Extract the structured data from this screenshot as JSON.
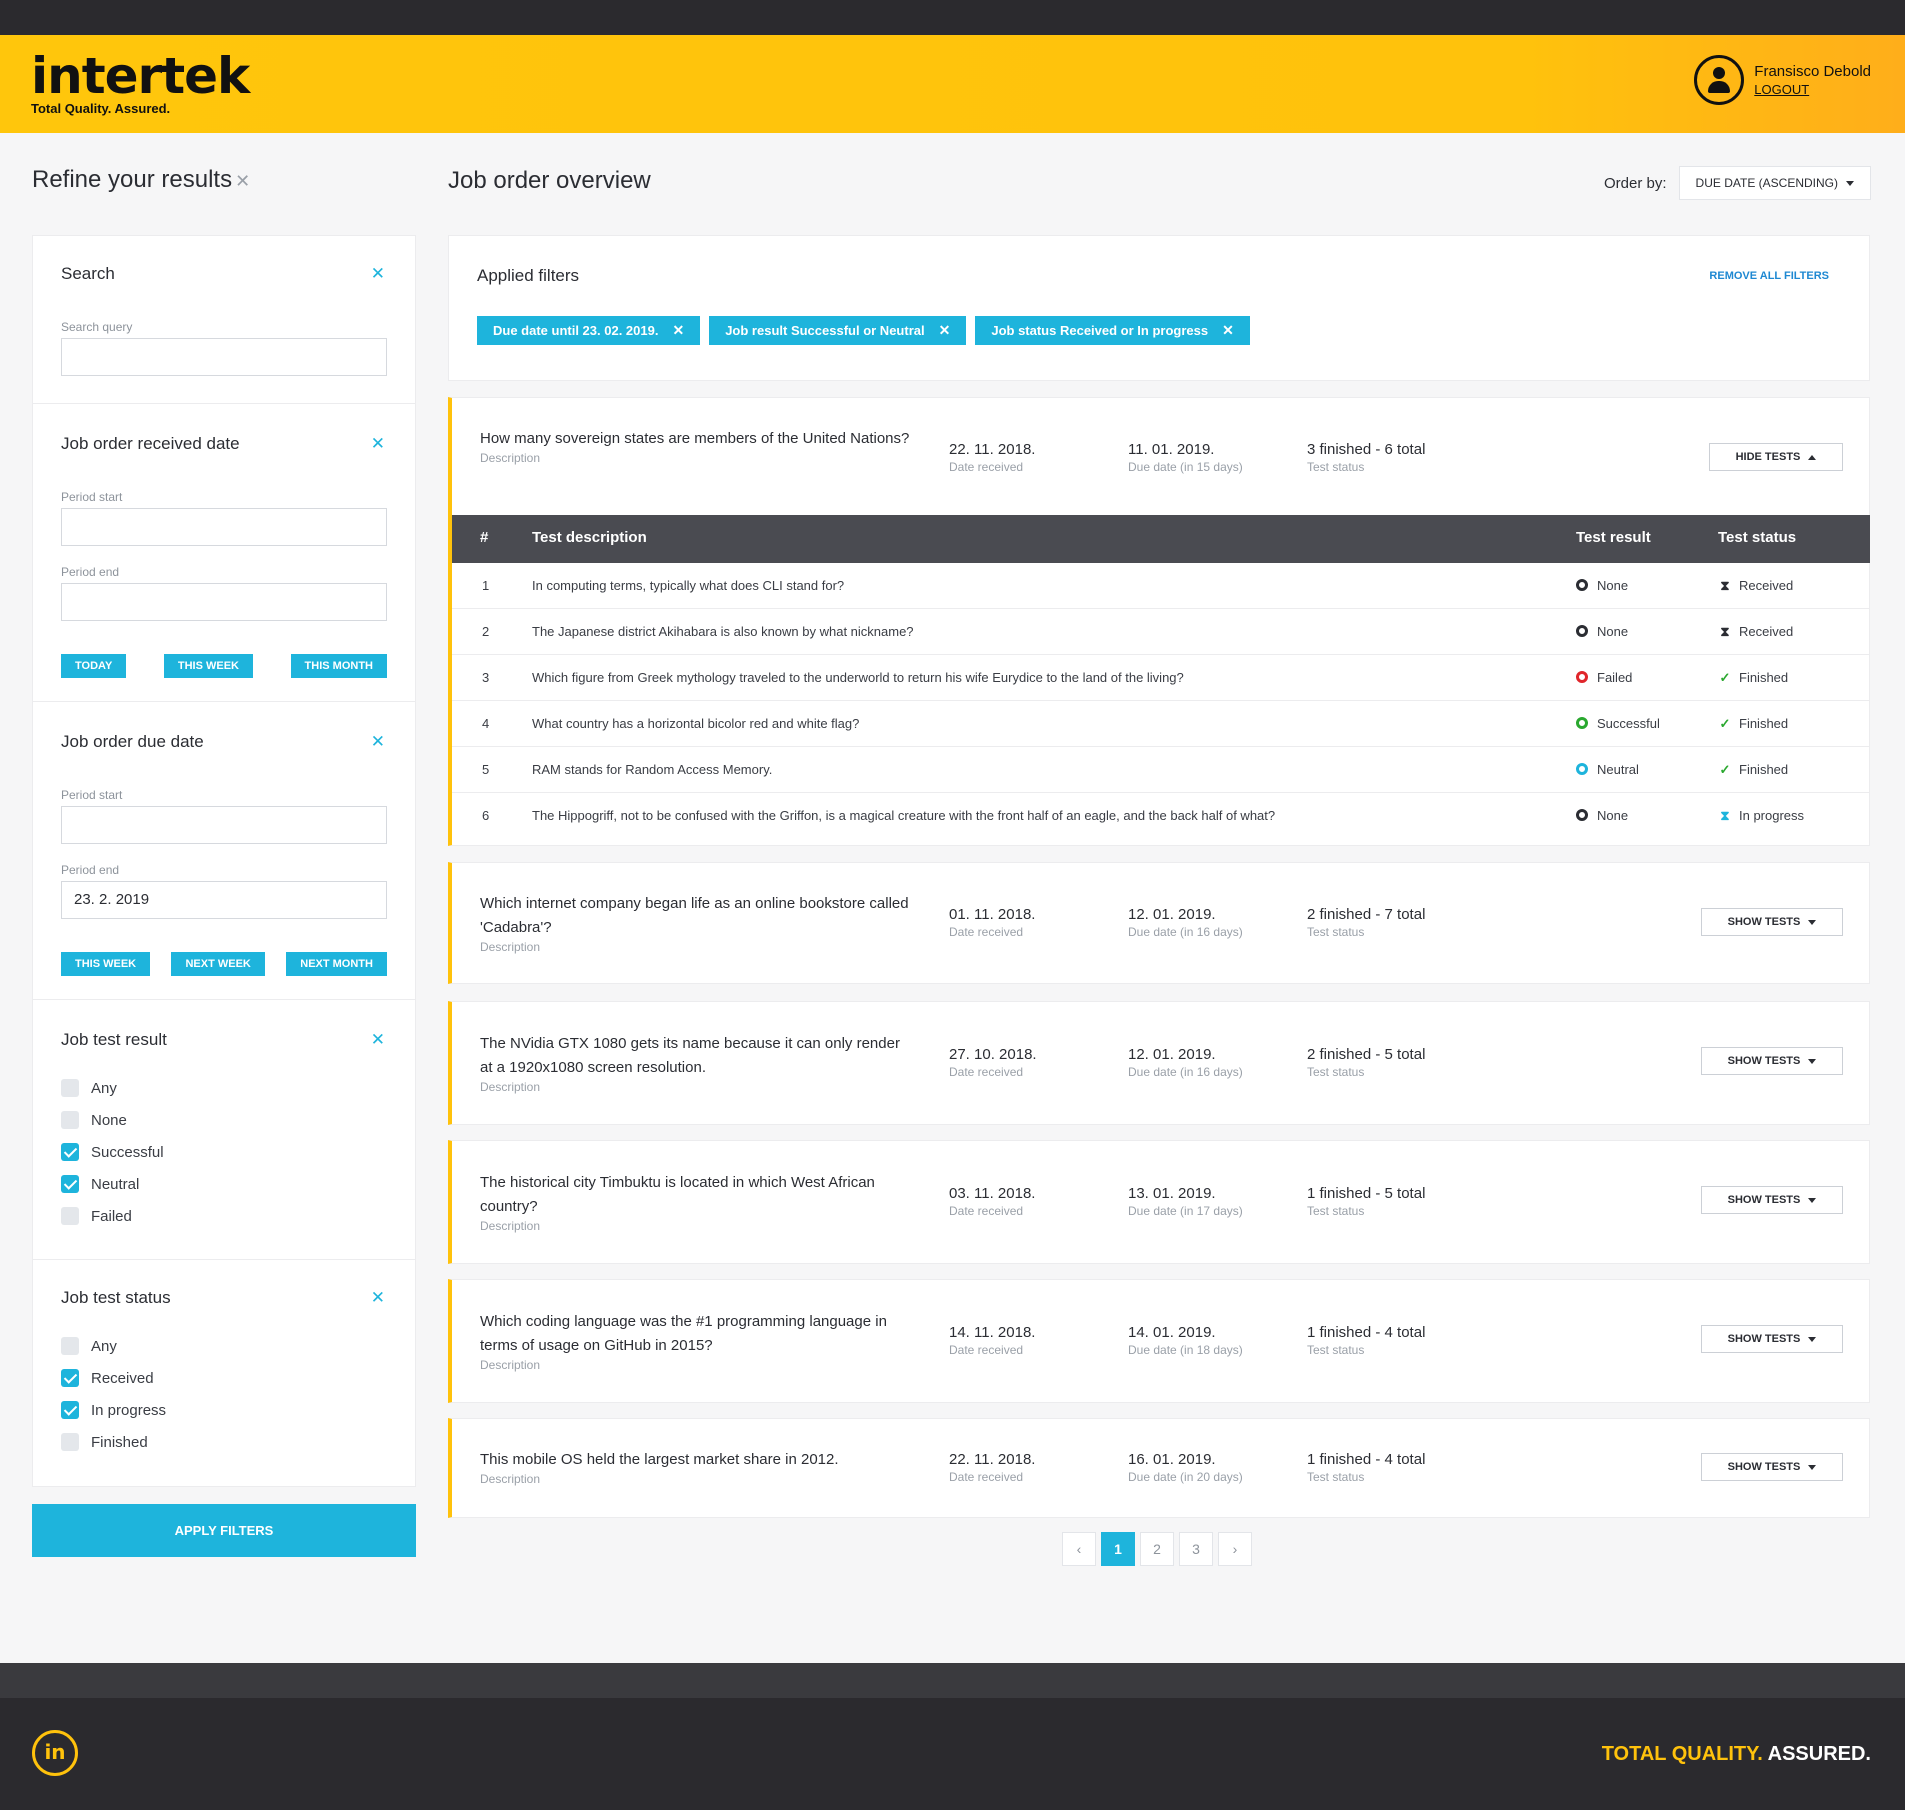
{
  "header": {
    "logo_text": "intertek",
    "logo_tagline": "Total Quality. Assured.",
    "user_name": "Fransisco Debold",
    "logout_label": "LOGOUT"
  },
  "sidebar": {
    "title": "Refine your results",
    "search": {
      "title": "Search",
      "label": "Search query",
      "value": ""
    },
    "received": {
      "title": "Job order received date",
      "start_label": "Period start",
      "start_value": "",
      "end_label": "Period end",
      "end_value": "",
      "buttons": [
        "TODAY",
        "THIS WEEK",
        "THIS MONTH"
      ]
    },
    "due": {
      "title": "Job order due date",
      "start_label": "Period start",
      "start_value": "",
      "end_label": "Period end",
      "end_value": "23. 2. 2019",
      "buttons": [
        "THIS WEEK",
        "NEXT WEEK",
        "NEXT MONTH"
      ]
    },
    "result": {
      "title": "Job test result",
      "options": [
        {
          "label": "Any",
          "checked": false
        },
        {
          "label": "None",
          "checked": false
        },
        {
          "label": "Successful",
          "checked": true
        },
        {
          "label": "Neutral",
          "checked": true
        },
        {
          "label": "Failed",
          "checked": false
        }
      ]
    },
    "status": {
      "title": "Job test status",
      "options": [
        {
          "label": "Any",
          "checked": false
        },
        {
          "label": "Received",
          "checked": true
        },
        {
          "label": "In progress",
          "checked": true
        },
        {
          "label": "Finished",
          "checked": false
        }
      ]
    },
    "apply_label": "APPLY FILTERS"
  },
  "main": {
    "title": "Job order overview",
    "order_label": "Order by:",
    "order_value": "DUE DATE (ASCENDING)",
    "filters": {
      "title": "Applied filters",
      "remove_all": "REMOVE ALL FILTERS",
      "chips": [
        "Due date until 23. 02. 2019.",
        "Job result Successful or Neutral",
        "Job status Received or In progress"
      ]
    },
    "labels": {
      "description": "Description",
      "date_received": "Date received",
      "test_status": "Test status",
      "hide_tests": "HIDE TESTS",
      "show_tests": "SHOW TESTS"
    },
    "jobs": [
      {
        "q": "How many sovereign states are members of the United Nations?",
        "received": "22. 11. 2018.",
        "due": "11. 01. 2019.",
        "due_sub": "Due date (in 15 days)",
        "status": "3 finished - 6 total"
      },
      {
        "q": "Which internet company began life as an online bookstore called 'Cadabra'?",
        "received": "01. 11. 2018.",
        "due": "12. 01. 2019.",
        "due_sub": "Due date (in 16 days)",
        "status": "2 finished - 7 total"
      },
      {
        "q": "The NVidia GTX 1080 gets its name because it can only render at a 1920x1080 screen resolution.",
        "received": "27. 10. 2018.",
        "due": "12. 01. 2019.",
        "due_sub": "Due date (in 16 days)",
        "status": "2 finished - 5 total"
      },
      {
        "q": "The historical city Timbuktu is located in which West African country?",
        "received": "03. 11. 2018.",
        "due": "13. 01. 2019.",
        "due_sub": "Due date (in 17 days)",
        "status": "1 finished - 5 total"
      },
      {
        "q": "Which coding language was the #1 programming language in terms of usage on GitHub in 2015?",
        "received": "14. 11. 2018.",
        "due": "14. 01. 2019.",
        "due_sub": "Due date (in 18 days)",
        "status": "1 finished - 4 total"
      },
      {
        "q": "This mobile OS held the largest market share in 2012.",
        "received": "22. 11. 2018.",
        "due": "16. 01. 2019.",
        "due_sub": "Due date (in 20 days)",
        "status": "1 finished - 4 total"
      }
    ],
    "tests": {
      "headers": {
        "num": "#",
        "desc": "Test description",
        "result": "Test result",
        "status": "Test status"
      },
      "rows": [
        {
          "n": "1",
          "desc": "In computing terms, typically what does CLI stand for?",
          "result": "None",
          "result_color": "#2b2d33",
          "status": "Received",
          "status_icon": "hourglass-icon"
        },
        {
          "n": "2",
          "desc": "The Japanese district Akihabara is also known by what nickname?",
          "result": "None",
          "result_color": "#2b2d33",
          "status": "Received",
          "status_icon": "hourglass-icon"
        },
        {
          "n": "3",
          "desc": "Which figure from Greek mythology traveled to the underworld to return his wife Eurydice to the land of the living?",
          "result": "Failed",
          "result_color": "#e0262b",
          "status": "Finished",
          "status_icon": "check-icon"
        },
        {
          "n": "4",
          "desc": "What country has a horizontal bicolor red and white flag?",
          "result": "Successful",
          "result_color": "#2aa82f",
          "status": "Finished",
          "status_icon": "check-icon"
        },
        {
          "n": "5",
          "desc": "RAM stands for Random Access Memory.",
          "result": "Neutral",
          "result_color": "#1eb4dc",
          "status": "Finished",
          "status_icon": "check-icon"
        },
        {
          "n": "6",
          "desc": "The Hippogriff, not to be confused with the Griffon, is a magical creature with the front half of an eagle, and the back half of what?",
          "result": "None",
          "result_color": "#2b2d33",
          "status": "In progress",
          "status_icon": "hourglass-progress-icon"
        }
      ]
    },
    "pager": {
      "prev": "‹",
      "pages": [
        "1",
        "2",
        "3"
      ],
      "active": "1",
      "next": "›"
    }
  },
  "footer": {
    "logo_text": "in",
    "tagline_a": "TOTAL QUALITY.",
    "tagline_b": "ASSURED."
  },
  "colors": {
    "accent": "#1eb4dc",
    "brand": "#ffc20c",
    "dark": "#2b2a2e"
  }
}
